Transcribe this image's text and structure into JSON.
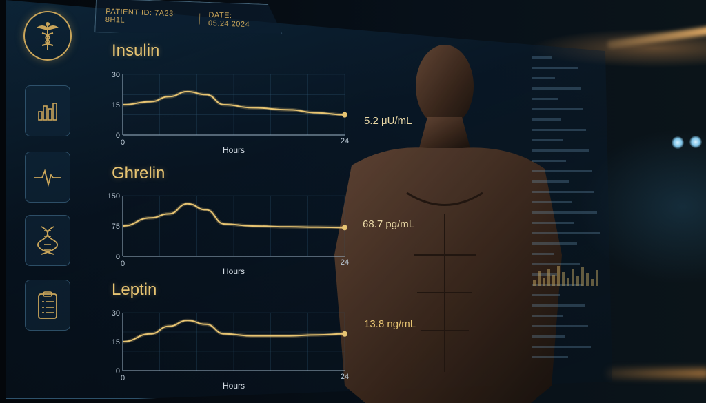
{
  "header": {
    "patient_id": "PATIENT ID: 7A23-8H1L",
    "date": "DATE: 05.24.2024"
  },
  "sidebar": {
    "items": [
      {
        "icon": "caduceus-icon"
      },
      {
        "icon": "bar-chart-icon"
      },
      {
        "icon": "heartbeat-icon"
      },
      {
        "icon": "dna-icon"
      },
      {
        "icon": "clipboard-icon"
      }
    ]
  },
  "colors": {
    "accent_gold": "#e7c472",
    "grid": "#2f5672",
    "panel_border": "#6eaad2"
  },
  "chart_data": [
    {
      "type": "line",
      "title": "Insulin",
      "xlabel": "Hours",
      "xlim": [
        0,
        24
      ],
      "ylim": [
        0,
        30
      ],
      "y_ticks": [
        "30",
        "15",
        "0"
      ],
      "x_ticks": [
        "0",
        "24"
      ],
      "series": [
        {
          "x": [
            0,
            3,
            5,
            7,
            9,
            11,
            14,
            18,
            21,
            24
          ],
          "y": [
            15,
            16.5,
            19,
            21.5,
            20,
            15,
            13.5,
            12.5,
            11,
            10
          ]
        }
      ],
      "end_label": "5.2 μU/mL"
    },
    {
      "type": "line",
      "title": "Ghrelin",
      "xlabel": "Hours",
      "xlim": [
        0,
        24
      ],
      "ylim": [
        0,
        150
      ],
      "y_ticks": [
        "150",
        "75",
        "0"
      ],
      "x_ticks": [
        "0",
        "24"
      ],
      "series": [
        {
          "x": [
            0,
            3,
            5,
            7,
            9,
            11,
            14,
            18,
            21,
            24
          ],
          "y": [
            75,
            95,
            105,
            130,
            115,
            80,
            75,
            73,
            72,
            71
          ]
        }
      ],
      "end_label": "68.7 pg/mL"
    },
    {
      "type": "line",
      "title": "Leptin",
      "xlabel": "Hours",
      "xlim": [
        0,
        24
      ],
      "ylim": [
        0,
        30
      ],
      "y_ticks": [
        "30",
        "15",
        "0"
      ],
      "x_ticks": [
        "0",
        "24"
      ],
      "series": [
        {
          "x": [
            0,
            3,
            5,
            7,
            9,
            11,
            14,
            18,
            21,
            24
          ],
          "y": [
            15,
            19,
            23,
            26,
            24,
            19,
            18,
            18,
            18.5,
            19
          ]
        }
      ],
      "end_label": "13.8 ng/mL"
    }
  ]
}
